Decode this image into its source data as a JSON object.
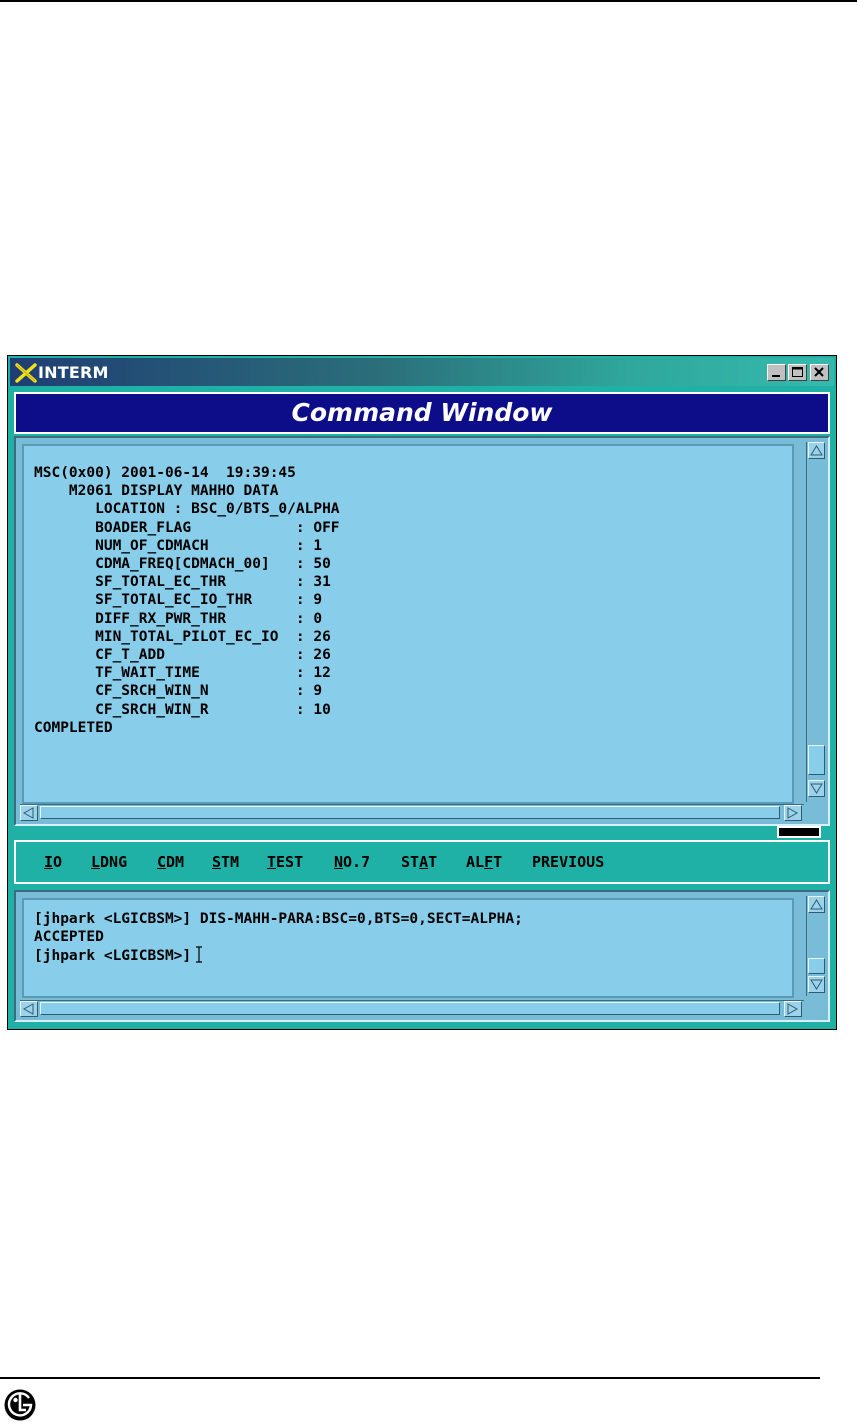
{
  "window": {
    "title": "INTERM",
    "header": "Command Window",
    "controls": [
      "minimize-icon",
      "maximize-icon",
      "close-icon"
    ]
  },
  "output": {
    "lines": [
      "MSC(0x00) 2001-06-14  19:39:45",
      "    M2061 DISPLAY MAHHO DATA",
      "       LOCATION : BSC_0/BTS_0/ALPHA",
      "       BOADER_FLAG            : OFF",
      "       NUM_OF_CDMACH          : 1",
      "       CDMA_FREQ[CDMACH_00]   : 50",
      "       SF_TOTAL_EC_THR        : 31",
      "       SF_TOTAL_EC_IO_THR     : 9",
      "       DIFF_RX_PWR_THR        : 0",
      "       MIN_TOTAL_PILOT_EC_IO  : 26",
      "       CF_T_ADD               : 26",
      "       TF_WAIT_TIME           : 12",
      "       CF_SRCH_WIN_N          : 9",
      "       CF_SRCH_WIN_R          : 10",
      "COMPLETED"
    ]
  },
  "menu": {
    "items": [
      {
        "label": "IO",
        "underline_index": 0
      },
      {
        "label": "LDNG",
        "underline_index": 0
      },
      {
        "label": "CDM",
        "underline_index": 0
      },
      {
        "label": "STM",
        "underline_index": 0
      },
      {
        "label": "TEST",
        "underline_index": 0
      },
      {
        "label": "NO.7",
        "underline_index": 0
      },
      {
        "label": "STAT",
        "underline_index": 2
      },
      {
        "label": "ALFT",
        "underline_index": 2
      },
      {
        "label": "PREVIOUS",
        "underline_index": -1
      }
    ]
  },
  "input": {
    "lines": [
      "[jhpark <LGICBSM>] DIS-MAHH-PARA:BSC=0,BTS=0,SECT=ALPHA;",
      "ACCEPTED"
    ],
    "prompt": "[jhpark <LGICBSM>]"
  },
  "colors": {
    "frame": "#1fb1a5",
    "header_bg": "#0d0d8a",
    "pane_bg": "#88cdea"
  }
}
